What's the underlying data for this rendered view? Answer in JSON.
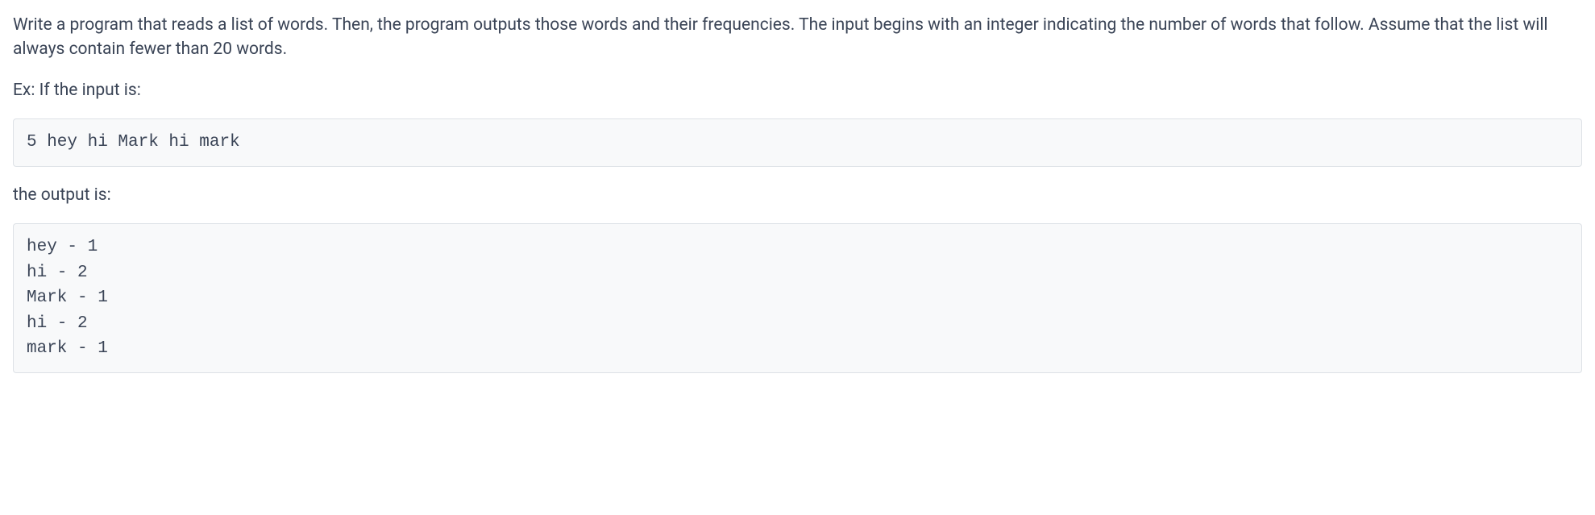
{
  "paragraphs": {
    "intro": "Write a program that reads a list of words. Then, the program outputs those words and their frequencies. The input begins with an integer indicating the number of words that follow. Assume that the list will always contain fewer than 20 words.",
    "example_label": "Ex: If the input is:",
    "output_label": "the output is:"
  },
  "code": {
    "input_example": "5 hey hi Mark hi mark",
    "output_example": "hey - 1\nhi - 2\nMark - 1\nhi - 2\nmark - 1"
  }
}
